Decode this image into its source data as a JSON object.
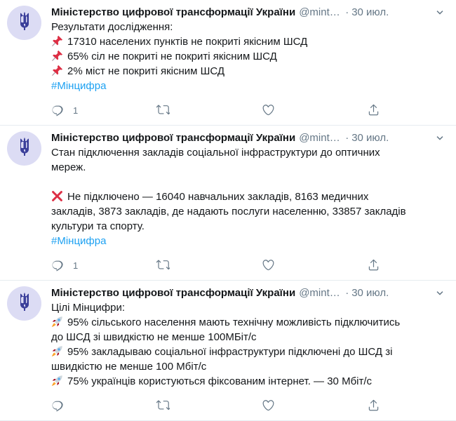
{
  "tweets": [
    {
      "author": "Міністерство цифрової трансформації України",
      "handle": "@mintsyfra",
      "time": "30 июл.",
      "lines": [
        {
          "text": "Результати дослідження:"
        },
        {
          "emoji": "pin-icon",
          "text": "17310 населених пунктів не покриті якісним ШСД"
        },
        {
          "emoji": "pin-icon",
          "text": "65% сіл не покриті не покриті якісним ШСД"
        },
        {
          "emoji": "pin-icon",
          "text": "2% міст не покриті якісним ШСД"
        }
      ],
      "hashtag": "#Мінцифра",
      "reply_count": "1"
    },
    {
      "author": "Міністерство цифрової трансформації України",
      "handle": "@mintsyfra",
      "time": "30 июл.",
      "lines": [
        {
          "text": "Стан підключення закладів соціальної інфраструктури до оптичних"
        },
        {
          "text": "мереж."
        },
        {
          "text": ""
        },
        {
          "emoji": "cross-icon",
          "text": "Не підключено — 16040 навчальних закладів, 8163 медичних"
        },
        {
          "text": "закладів, 3873 закладів, де надають послуги населенню, 33857 закладів"
        },
        {
          "text": "культури та спорту."
        }
      ],
      "hashtag": "#Мінцифра",
      "reply_count": "1"
    },
    {
      "author": "Міністерство цифрової трансформації України",
      "handle": "@mintsyfra",
      "time": "30 июл.",
      "lines": [
        {
          "text": "Цілі Мінцифри:"
        },
        {
          "emoji": "rocket-icon",
          "text": "95% сільського населення мають технічну можливість підключитись"
        },
        {
          "text": "до ШСД зі швидкістю не менше 100МБіт/с"
        },
        {
          "emoji": "rocket-icon",
          "text": "95% закладываю соціальної інфраструктури підключені до ШСД зі"
        },
        {
          "text": "швидкістю не менше 100 Мбіт/с"
        },
        {
          "emoji": "rocket-icon",
          "text": "75% українців користуються фіксованим інтернет. — 30 Мбіт/с"
        }
      ],
      "hashtag": "",
      "reply_count": ""
    }
  ],
  "colors": {
    "link": "#1da1f2",
    "muted": "#657786",
    "avatar_bg": "#dcdcf4",
    "trident": "#3b3f9a"
  }
}
